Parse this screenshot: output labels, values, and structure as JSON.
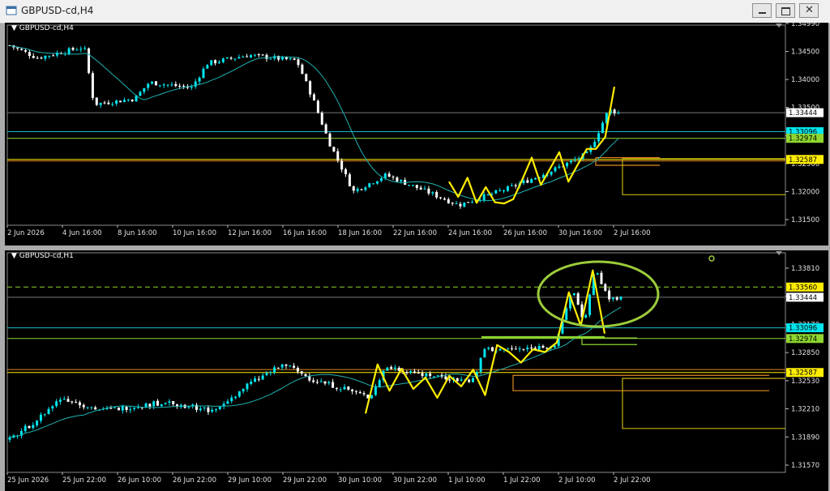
{
  "window": {
    "title": "GBPUSD-cd,H4"
  },
  "colors": {
    "bull": "#00e5ee",
    "bear": "#ffffff",
    "ma": "#1fb2b2",
    "yellow": "#ffee00",
    "grid": "#787878",
    "lime": "#8fd630",
    "orange": "#e08a20",
    "olive": "#c8b014",
    "cyan_line": "#18b8c8"
  },
  "chart_data": [
    {
      "type": "candlestick",
      "title": "GBPUSD-cd,H4",
      "ytick_labels": [
        "1.34990",
        "1.34500",
        "1.34000",
        "1.33500",
        "1.33000",
        "1.32500",
        "1.32000",
        "1.31500"
      ],
      "ylim": [
        1.3138,
        1.3505
      ],
      "xtick_labels": [
        "2 Jun 2026",
        "4 Jun 16:00",
        "8 Jun 16:00",
        "10 Jun 16:00",
        "12 Jun 16:00",
        "16 Jun 16:00",
        "18 Jun 16:00",
        "22 Jun 16:00",
        "24 Jun 16:00",
        "26 Jun 16:00",
        "30 Jun 16:00",
        "2 Jul 16:00"
      ],
      "price_labels": [
        {
          "text": "1.33444",
          "value": 1.33444,
          "color": "#ffffff",
          "text_color": "#000000"
        },
        {
          "text": "1.33096",
          "value": 1.33096,
          "color": "#00e5ee",
          "text_color": "#000000"
        },
        {
          "text": "1.32974",
          "value": 1.32974,
          "color": "#8fd630",
          "text_color": "#000000"
        },
        {
          "text": "1.32587",
          "value": 1.32587,
          "color": "#ffee00",
          "text_color": "#000000"
        }
      ],
      "horizontal_lines": [
        {
          "value": 1.33444,
          "color": "#787878"
        },
        {
          "value": 1.33096,
          "color": "#18b8c8"
        },
        {
          "value": 1.32974,
          "color": "#8fd630"
        },
        {
          "value": 1.32587,
          "color": "#ffee00"
        },
        {
          "value": 1.3256,
          "color": "#e08a20"
        }
      ],
      "path_anchors": [
        1.3218,
        1.319,
        1.3225,
        1.3179,
        1.3208,
        1.318,
        1.3178,
        1.3186,
        1.3223,
        1.3262,
        1.3212,
        1.3242,
        1.3272,
        1.3218,
        1.3249,
        1.3278,
        1.3278,
        1.33,
        1.3392
      ]
    },
    {
      "type": "candlestick",
      "title": "GBPUSD-cd,H1",
      "ytick_labels": [
        "1.33810",
        "1.33490",
        "1.33170",
        "1.32850",
        "1.32530",
        "1.32210",
        "1.31890",
        "1.31570"
      ],
      "ylim": [
        1.3145,
        1.3395
      ],
      "xtick_labels": [
        "25 Jun 2026",
        "25 Jun 22:00",
        "26 Jun 10:00",
        "26 Jun 22:00",
        "29 Jun 10:00",
        "29 Jun 22:00",
        "30 Jun 10:00",
        "30 Jun 22:00",
        "1 Jul 10:00",
        "1 Jul 22:00",
        "2 Jul 10:00",
        "2 Jul 22:00"
      ],
      "price_labels": [
        {
          "text": "1.33560",
          "value": 1.3356,
          "color": "#ffee00",
          "text_color": "#000000"
        },
        {
          "text": "1.33444",
          "value": 1.33444,
          "color": "#ffffff",
          "text_color": "#000000"
        },
        {
          "text": "1.33096",
          "value": 1.33096,
          "color": "#00e5ee",
          "text_color": "#000000"
        },
        {
          "text": "1.32974",
          "value": 1.32974,
          "color": "#8fd630",
          "text_color": "#000000"
        },
        {
          "text": "1.32587",
          "value": 1.32587,
          "color": "#ffee00",
          "text_color": "#000000"
        }
      ],
      "horizontal_lines": [
        {
          "value": 1.3356,
          "color": "#8fd630",
          "dashed": true
        },
        {
          "value": 1.33444,
          "color": "#787878"
        },
        {
          "value": 1.33096,
          "color": "#18b8c8"
        },
        {
          "value": 1.32974,
          "color": "#8fd630"
        },
        {
          "value": 1.3262,
          "color": "#e08a20"
        },
        {
          "value": 1.32587,
          "color": "#ffee00"
        }
      ],
      "path_anchors": [
        1.3212,
        1.3268,
        1.3238,
        1.3263,
        1.324,
        1.3253,
        1.323,
        1.3255,
        1.3243,
        1.3262,
        1.3233,
        1.329,
        1.3282,
        1.327,
        1.3285,
        1.3282,
        1.3293,
        1.335,
        1.3312,
        1.3375,
        1.3303
      ]
    }
  ]
}
